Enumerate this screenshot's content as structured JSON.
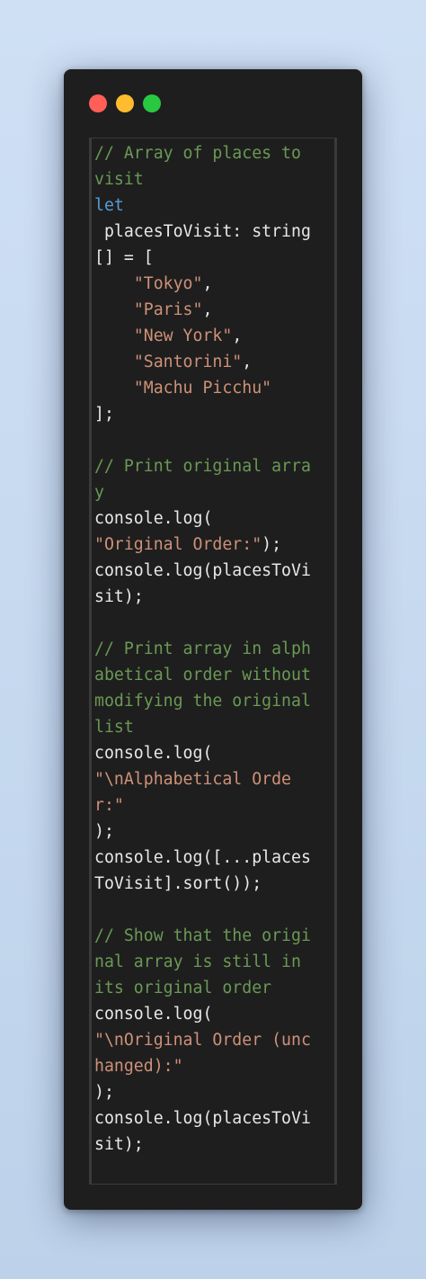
{
  "window": {
    "controls": [
      "close",
      "minimize",
      "maximize"
    ],
    "colors": {
      "close": "#ff5f57",
      "minimize": "#febc2e",
      "maximize": "#28c840",
      "background": "#1e1e1e"
    }
  },
  "code": {
    "syntax_colors": {
      "comment": "#6a9955",
      "keyword": "#569cd6",
      "string": "#ce9178",
      "plain": "#e8e8e8"
    },
    "lines": [
      [
        {
          "t": "comment",
          "v": "// Array of places to"
        }
      ],
      [
        {
          "t": "comment",
          "v": "visit"
        }
      ],
      [
        {
          "t": "keyword",
          "v": "let"
        }
      ],
      [
        {
          "t": "plain",
          "v": " placesToVisit: string"
        }
      ],
      [
        {
          "t": "plain",
          "v": "[] = ["
        }
      ],
      [
        {
          "t": "plain",
          "v": "    "
        },
        {
          "t": "string",
          "v": "\"Tokyo\""
        },
        {
          "t": "plain",
          "v": ","
        }
      ],
      [
        {
          "t": "plain",
          "v": "    "
        },
        {
          "t": "string",
          "v": "\"Paris\""
        },
        {
          "t": "plain",
          "v": ","
        }
      ],
      [
        {
          "t": "plain",
          "v": "    "
        },
        {
          "t": "string",
          "v": "\"New York\""
        },
        {
          "t": "plain",
          "v": ","
        }
      ],
      [
        {
          "t": "plain",
          "v": "    "
        },
        {
          "t": "string",
          "v": "\"Santorini\""
        },
        {
          "t": "plain",
          "v": ","
        }
      ],
      [
        {
          "t": "plain",
          "v": "    "
        },
        {
          "t": "string",
          "v": "\"Machu Picchu\""
        }
      ],
      [
        {
          "t": "plain",
          "v": "];"
        }
      ],
      [],
      [
        {
          "t": "comment",
          "v": "// Print original arra"
        }
      ],
      [
        {
          "t": "comment",
          "v": "y"
        }
      ],
      [
        {
          "t": "plain",
          "v": "console.log("
        }
      ],
      [
        {
          "t": "string",
          "v": "\"Original Order:\""
        },
        {
          "t": "plain",
          "v": ");"
        }
      ],
      [
        {
          "t": "plain",
          "v": "console.log(placesToVi"
        }
      ],
      [
        {
          "t": "plain",
          "v": "sit);"
        }
      ],
      [],
      [
        {
          "t": "comment",
          "v": "// Print array in alph"
        }
      ],
      [
        {
          "t": "comment",
          "v": "abetical order without"
        }
      ],
      [
        {
          "t": "comment",
          "v": "modifying the original"
        }
      ],
      [
        {
          "t": "comment",
          "v": "list"
        }
      ],
      [
        {
          "t": "plain",
          "v": "console.log("
        }
      ],
      [
        {
          "t": "string",
          "v": "\"\\nAlphabetical Orde"
        }
      ],
      [
        {
          "t": "string",
          "v": "r:\""
        }
      ],
      [
        {
          "t": "plain",
          "v": ");"
        }
      ],
      [
        {
          "t": "plain",
          "v": "console.log([...places"
        }
      ],
      [
        {
          "t": "plain",
          "v": "ToVisit].sort());"
        }
      ],
      [],
      [
        {
          "t": "comment",
          "v": "// Show that the origi"
        }
      ],
      [
        {
          "t": "comment",
          "v": "nal array is still in"
        }
      ],
      [
        {
          "t": "comment",
          "v": "its original order"
        }
      ],
      [
        {
          "t": "plain",
          "v": "console.log("
        }
      ],
      [
        {
          "t": "string",
          "v": "\"\\nOriginal Order (unc"
        }
      ],
      [
        {
          "t": "string",
          "v": "hanged):\""
        }
      ],
      [
        {
          "t": "plain",
          "v": ");"
        }
      ],
      [
        {
          "t": "plain",
          "v": "console.log(placesToVi"
        }
      ],
      [
        {
          "t": "plain",
          "v": "sit);"
        }
      ]
    ]
  }
}
